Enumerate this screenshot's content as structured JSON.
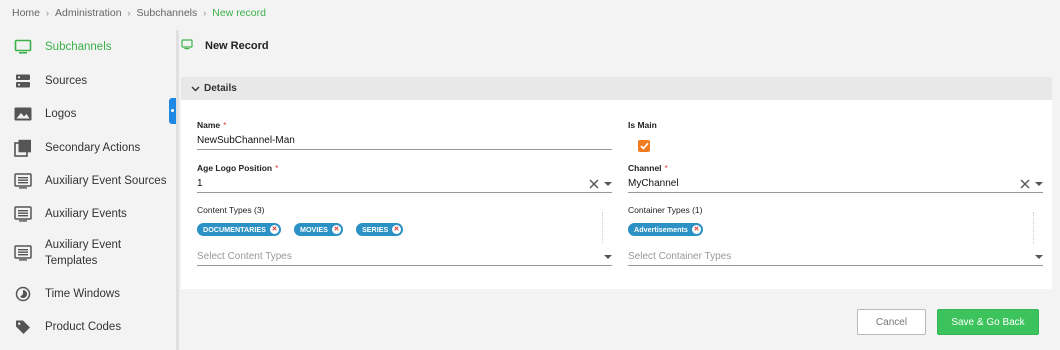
{
  "breadcrumb": {
    "items": [
      "Home",
      "Administration",
      "Subchannels"
    ],
    "current": "New record",
    "separator": "›"
  },
  "sidebar": {
    "items": [
      {
        "label": "Subchannels",
        "icon": "monitor-icon",
        "active": true
      },
      {
        "label": "Sources",
        "icon": "server-icon",
        "active": false
      },
      {
        "label": "Logos",
        "icon": "image-icon",
        "active": false
      },
      {
        "label": "Secondary Actions",
        "icon": "library-icon",
        "active": false
      },
      {
        "label": "Auxiliary Event Sources",
        "icon": "list-box-icon",
        "active": false
      },
      {
        "label": "Auxiliary Events",
        "icon": "list-box-icon",
        "active": false
      },
      {
        "label": "Auxiliary Event Templates",
        "icon": "list-box-icon",
        "active": false
      },
      {
        "label": "Time Windows",
        "icon": "timelapse-icon",
        "active": false
      },
      {
        "label": "Product Codes",
        "icon": "tag-icon",
        "active": false
      }
    ]
  },
  "page": {
    "title": "New Record",
    "icon": "monitor-icon"
  },
  "details": {
    "title": "Details",
    "name": {
      "label": "Name",
      "value": "NewSubChannel-Man",
      "required": "*"
    },
    "is_main": {
      "label": "Is Main",
      "checked": true
    },
    "age_logo_position": {
      "label": "Age Logo Position",
      "value": "1",
      "required": "*"
    },
    "channel": {
      "label": "Channel",
      "value": "MyChannel",
      "required": "*"
    },
    "content_types": {
      "label": "Content Types (3)",
      "chips": [
        "DOCUMENTARIES",
        "MOVIES",
        "SERIES"
      ],
      "placeholder": "Select Content Types"
    },
    "container_types": {
      "label": "Container Types (1)",
      "chips": [
        "Advertisements"
      ],
      "placeholder": "Select Container Types"
    }
  },
  "actions": {
    "cancel": "Cancel",
    "save": "Save & Go Back"
  },
  "colors": {
    "accent_green": "#3cb14a",
    "chip_blue": "#2c91c4",
    "checkbox_orange": "#f07c1f",
    "save_green": "#3cc35c",
    "required_red": "#e53935"
  }
}
